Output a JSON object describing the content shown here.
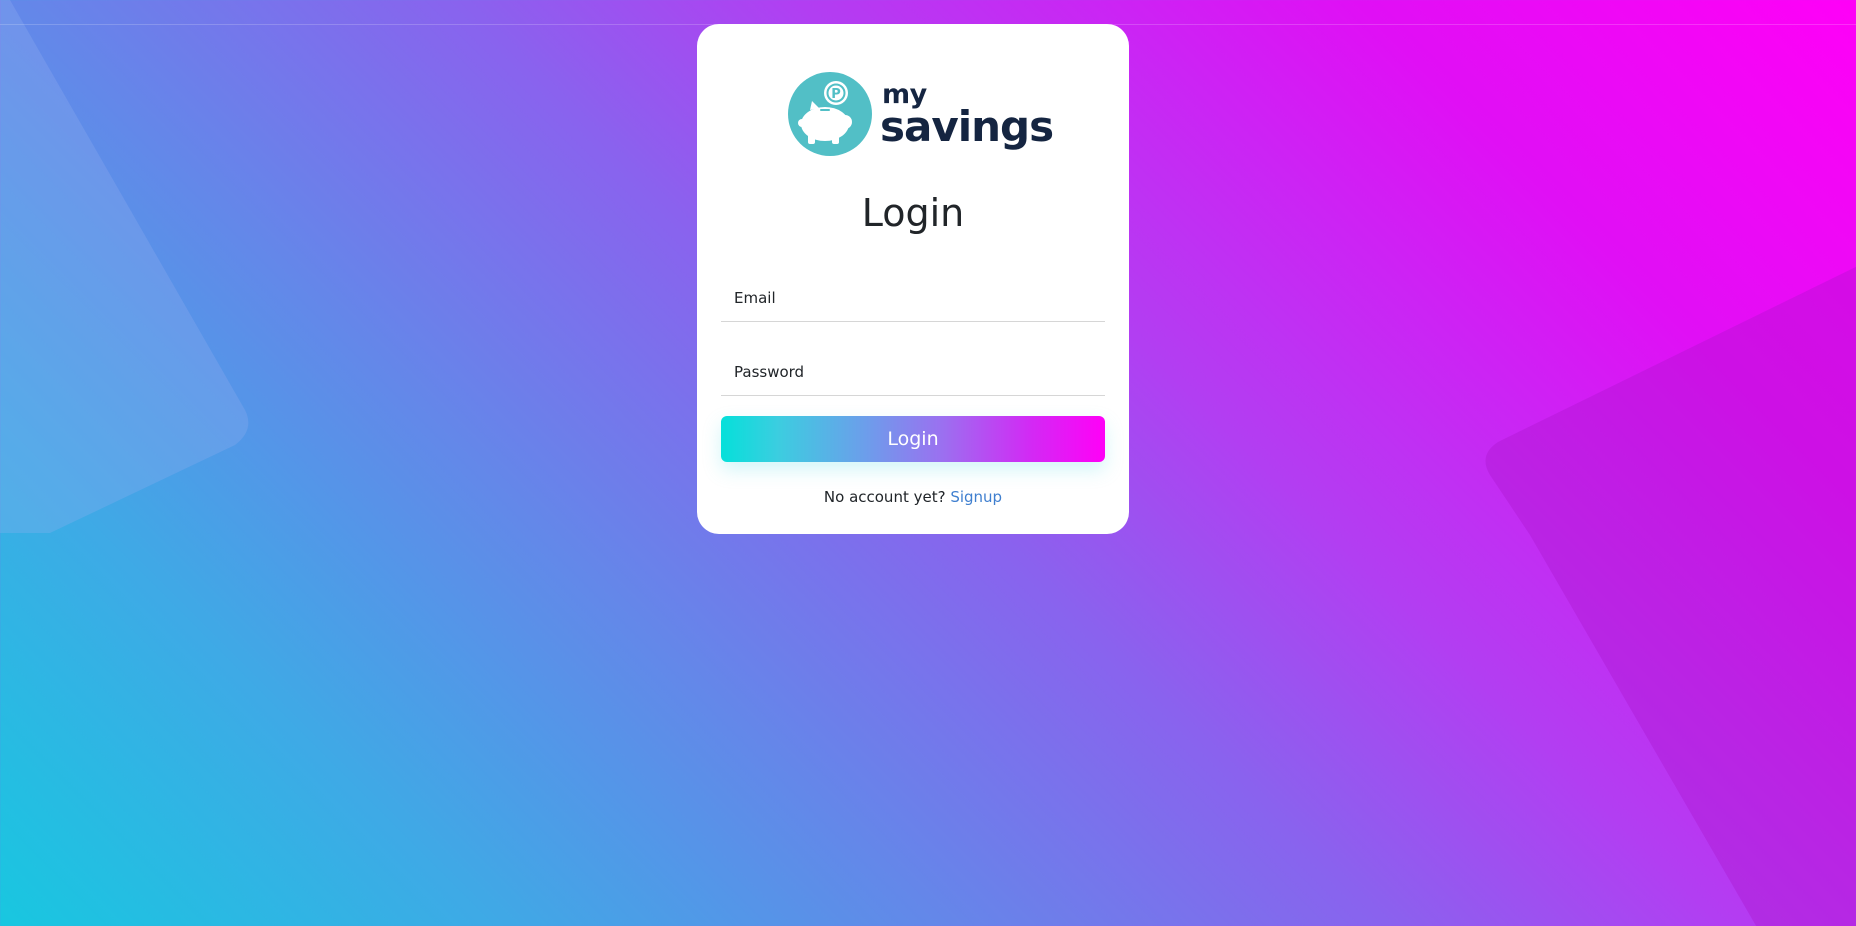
{
  "brand": {
    "logo_small": "my",
    "logo_large": "savings",
    "logo_icon": "piggy-bank-coin-icon"
  },
  "login": {
    "title": "Login",
    "email_placeholder": "Email",
    "password_placeholder": "Password",
    "button_label": "Login",
    "no_account_text": "No account yet?",
    "signup_link": "Signup"
  },
  "colors": {
    "logo_circle": "#52bfc6",
    "logo_text": "#152541",
    "link": "#3f7fcf",
    "gradient_start": "#05e0da",
    "gradient_end": "#ff00f7"
  }
}
